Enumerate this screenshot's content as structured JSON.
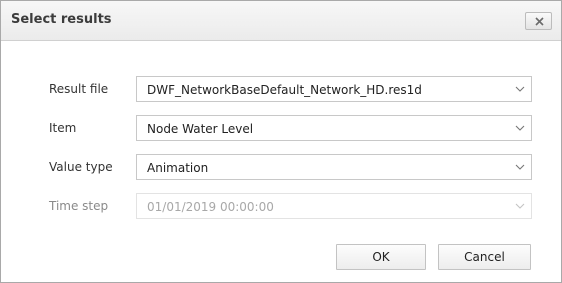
{
  "dialog": {
    "title": "Select results",
    "close_icon": "close-x-icon"
  },
  "fields": {
    "result_file": {
      "label": "Result file",
      "value": "DWF_NetworkBaseDefault_Network_HD.res1d"
    },
    "item": {
      "label": "Item",
      "value": "Node Water Level"
    },
    "value_type": {
      "label": "Value type",
      "value": "Animation"
    },
    "time_step": {
      "label": "Time step",
      "value": "01/01/2019 00:00:00",
      "disabled": true
    }
  },
  "buttons": {
    "ok": "OK",
    "cancel": "Cancel"
  },
  "icons": {
    "dropdown": "chevron-down-icon"
  }
}
